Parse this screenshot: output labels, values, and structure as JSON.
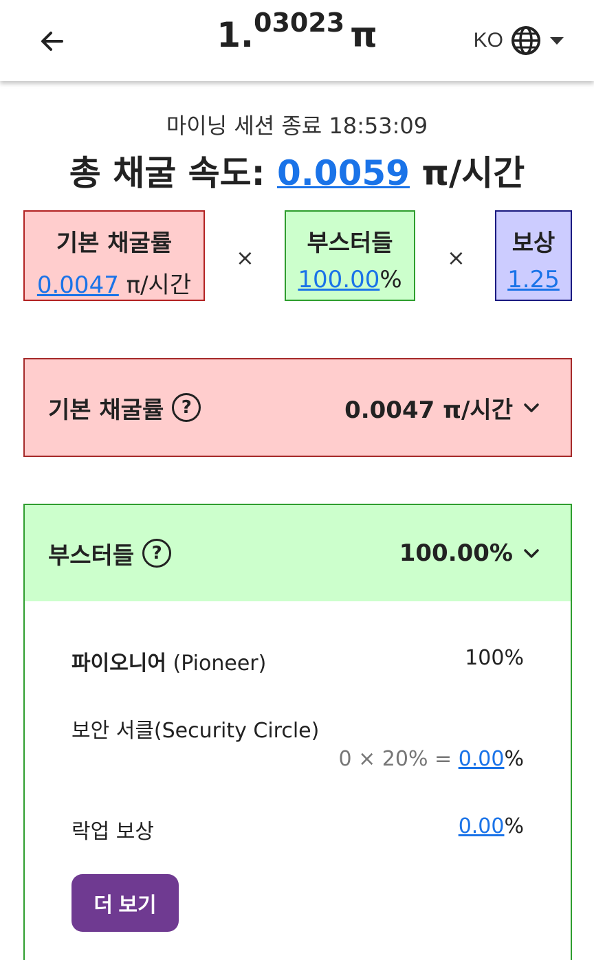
{
  "header": {
    "balance_int": "1.",
    "balance_dec": "03023",
    "balance_unit": "π",
    "lang_code": "KO"
  },
  "session": {
    "text": "마이닝 세션 종료 18:53:09"
  },
  "total": {
    "label": "총 채굴 속도:",
    "rate": "0.0059",
    "unit": "π/시간"
  },
  "formula": {
    "base": {
      "title": "기본 채굴률",
      "value": "0.0047",
      "unit": " π/시간"
    },
    "booster": {
      "title": "부스터들",
      "value": "100.00",
      "unit": "%"
    },
    "reward": {
      "title": "보상",
      "value": "1.25"
    },
    "times": "×"
  },
  "base_section": {
    "title": "기본 채굴률",
    "help": "?",
    "value": "0.0047 π/시간"
  },
  "booster_section": {
    "title": "부스터들",
    "help": "?",
    "value": "100.00%",
    "rows": [
      {
        "label_ko": "파이오니어",
        "label_en": " (Pioneer)",
        "value": "100%"
      },
      {
        "label": "보안 서클(Security Circle)",
        "formula": "0 × 20% = ",
        "value": "0.00",
        "unit": "%"
      },
      {
        "label": "락업 보상",
        "value": "0.00",
        "unit": "%"
      }
    ],
    "more_button": "더 보기"
  },
  "colors": {
    "link": "#1a73e8",
    "base_bg": "#ffcdcd",
    "booster_bg": "#ccffcc",
    "reward_bg": "#ccccff",
    "button": "#6f3a91"
  },
  "icons": [
    "arrow-left-icon",
    "globe-icon",
    "caret-down-icon",
    "chevron-down-icon",
    "help-icon"
  ]
}
